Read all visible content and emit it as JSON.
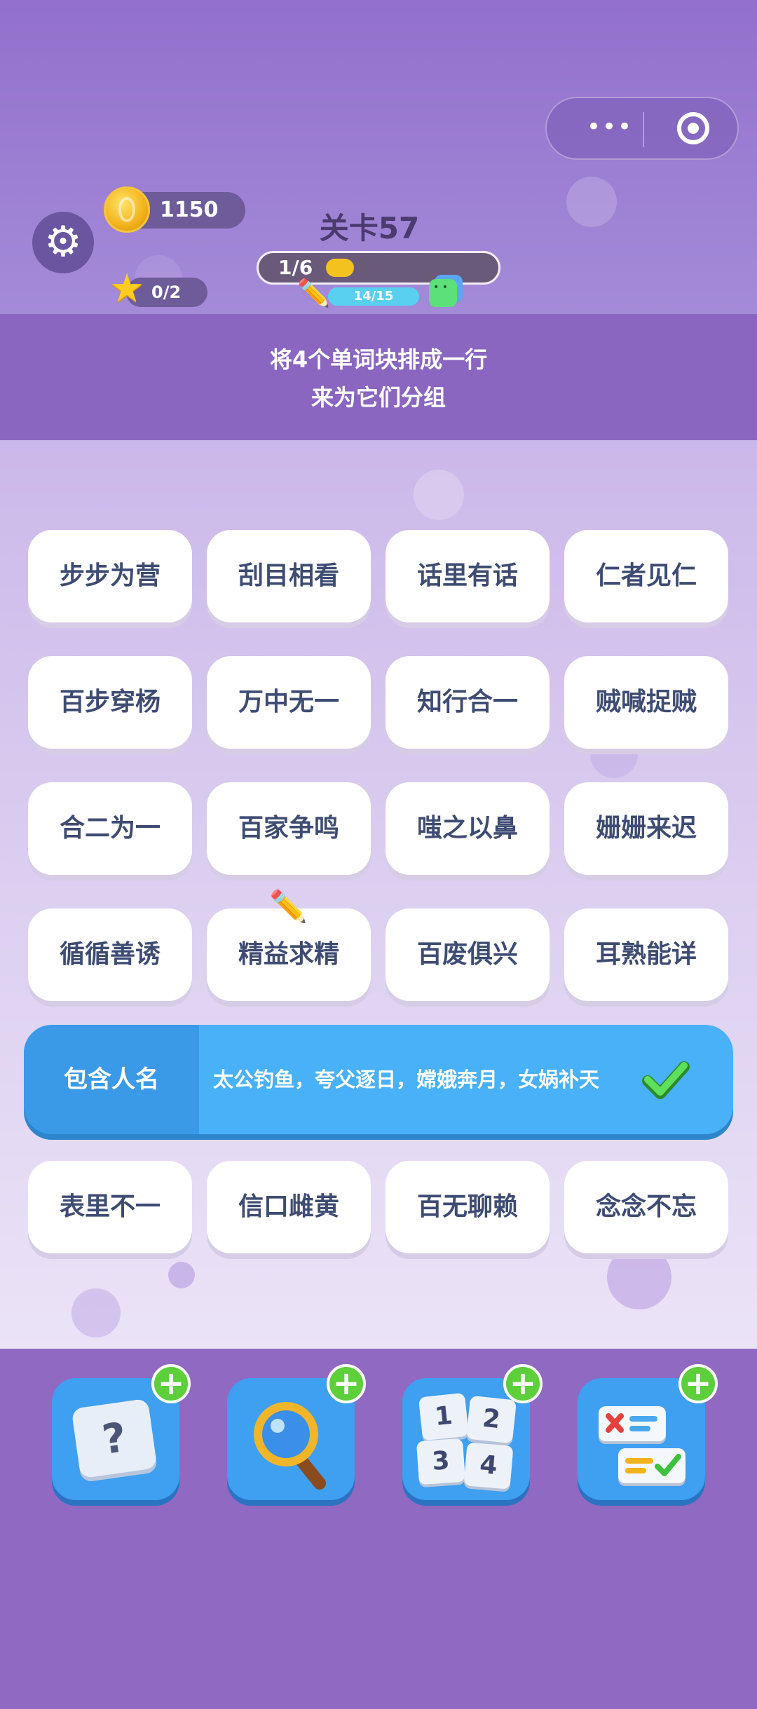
{
  "header": {
    "coins": "1150",
    "stars": "0/2",
    "level_title": "关卡57",
    "progress_text": "1/6",
    "progress_fraction": 0.1667,
    "sub_progress": "14/15",
    "sub_progress_fraction": 0.9333
  },
  "instructions": {
    "line1": "将4个单词块排成一行",
    "line2": "来为它们分组"
  },
  "grid": {
    "row1": [
      "步步为营",
      "刮目相看",
      "话里有话",
      "仁者见仁"
    ],
    "row2": [
      "百步穿杨",
      "万中无一",
      "知行合一",
      "贼喊捉贼"
    ],
    "row3": [
      "合二为一",
      "百家争鸣",
      "嗤之以鼻",
      "姗姗来迟"
    ],
    "row4": [
      "循循善诱",
      "精益求精",
      "百废俱兴",
      "耳熟能详"
    ],
    "row6": [
      "表里不一",
      "信口雌黄",
      "百无聊赖",
      "念念不忘"
    ]
  },
  "solved_group": {
    "category": "包含人名",
    "words": "太公钓鱼，夸父逐日，嫦娥奔月，女娲补天"
  },
  "tools": {
    "hint_icon": "question-card-icon",
    "search_icon": "magnifier-icon",
    "shuffle_numbers": [
      "1",
      "2",
      "3",
      "4"
    ],
    "check_icon": "cross-check-icon"
  },
  "colors": {
    "top_bg": "#9270cc",
    "banner_bg": "#8a66c0",
    "tile_text": "#3e4c73",
    "solved_blue": "#48b1f7",
    "tool_blue": "#3f9ff0",
    "plus_green": "#5ccf3a"
  }
}
